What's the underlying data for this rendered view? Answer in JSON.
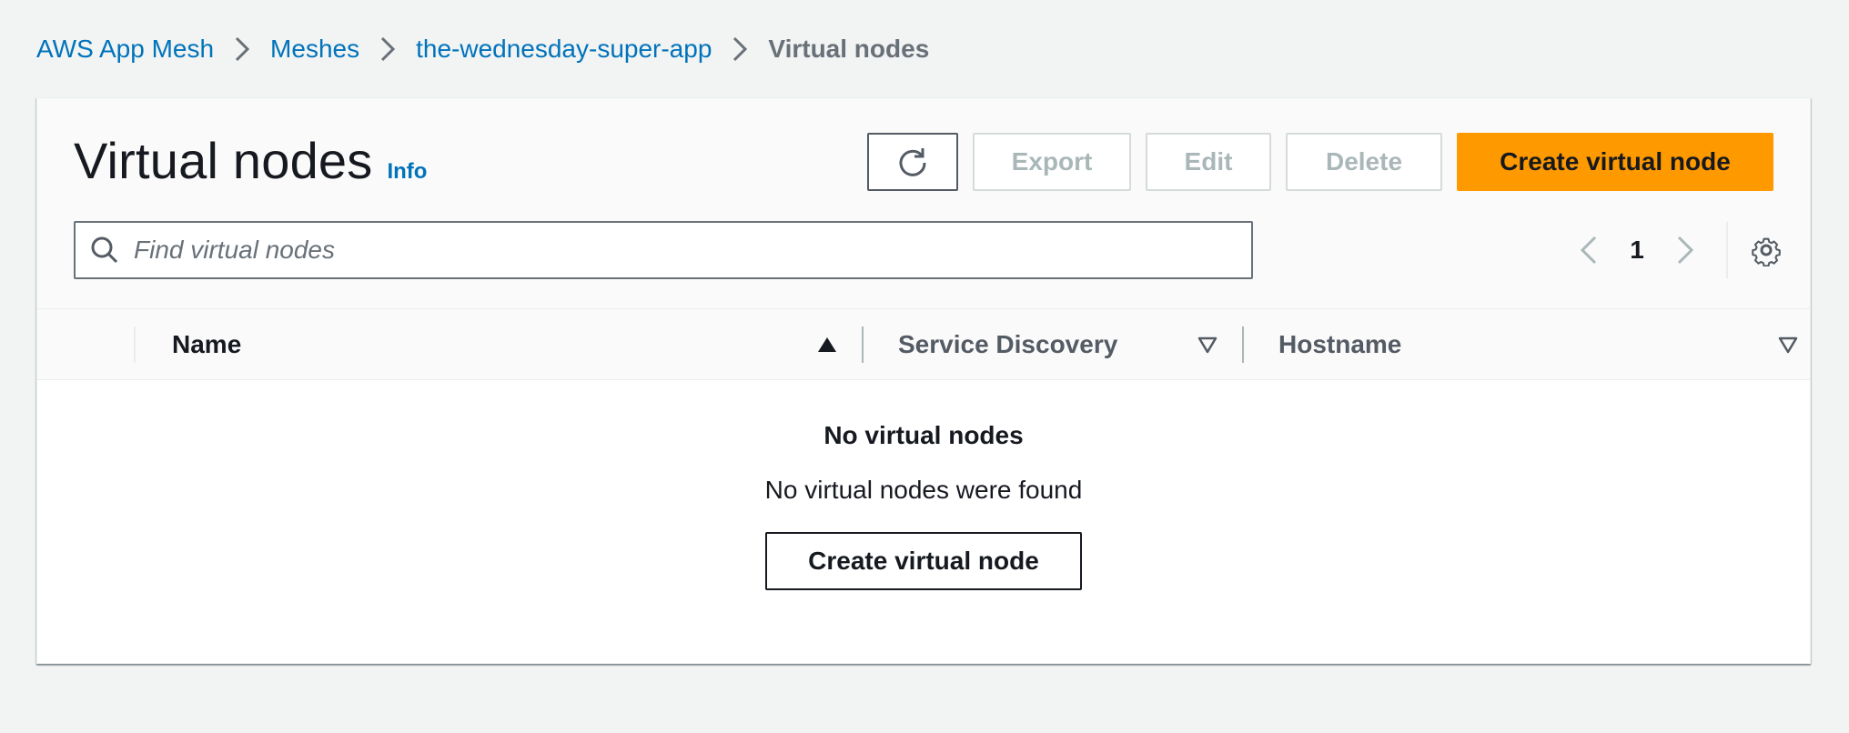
{
  "breadcrumb": {
    "items": [
      "AWS App Mesh",
      "Meshes",
      "the-wednesday-super-app"
    ],
    "current": "Virtual nodes"
  },
  "header": {
    "title": "Virtual nodes",
    "info_label": "Info"
  },
  "actions": {
    "refresh_icon": "refresh-icon",
    "export_label": "Export",
    "edit_label": "Edit",
    "delete_label": "Delete",
    "create_label": "Create virtual node"
  },
  "search": {
    "placeholder": "Find virtual nodes",
    "value": ""
  },
  "pagination": {
    "current_page": "1"
  },
  "table": {
    "columns": [
      "Name",
      "Service Discovery",
      "Hostname"
    ]
  },
  "empty_state": {
    "title": "No virtual nodes",
    "description": "No virtual nodes were found",
    "button_label": "Create virtual node"
  },
  "colors": {
    "primary": "#ff9900",
    "link": "#0073bb",
    "text": "#16191f",
    "muted": "#687078",
    "disabled": "#aab7b8",
    "background": "#f2f3f3"
  }
}
